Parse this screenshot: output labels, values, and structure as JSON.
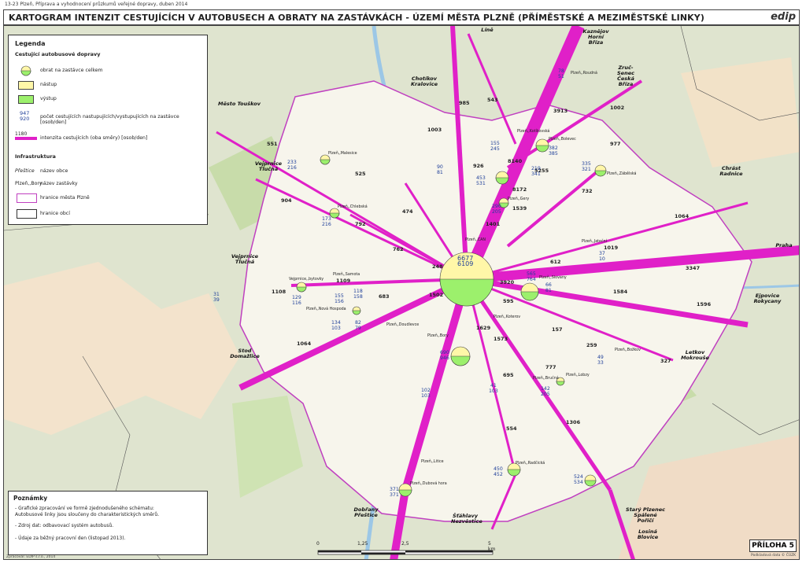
{
  "header": {
    "meta": "13-23 Plzeň, Příprava a vyhodnocení průzkumů veřejné dopravy, duben 2014",
    "title": "KARTOGRAM INTENZIT CESTUJÍCÍCH V AUTOBUSECH A OBRATY NA ZASTÁVKÁCH - ÚZEMÍ MĚSTA PLZNĚ (PŘÍMĚSTSKÉ A MEZIMĚSTSKÉ LINKY)",
    "logo": "edip"
  },
  "legend": {
    "title": "Legenda",
    "section_transport": "Cestující autobusové dopravy",
    "turnover": "obrat na zastávce celkem",
    "boarding": "nástup",
    "alighting": "výstup",
    "count_example_top": "947",
    "count_example_bottom": "920",
    "count_desc": "počet cestujících nastupujících/vystupujících na zastávce [osob/den]",
    "intensity_example": "1180",
    "intensity_desc": "intenzita cestujících (oba směry) [osob/den]",
    "section_infra": "Infrastruktura",
    "town_example": "Přeštice",
    "town_desc": "název obce",
    "stop_example": "Plzeň,,Bory",
    "stop_desc": "název zastávky",
    "city_boundary": "hranice města Plzně",
    "municipal_boundary": "hranice obcí",
    "colors": {
      "boarding": "#fff7a8",
      "alighting": "#9cf06c",
      "flow": "#e020c8",
      "city_boundary": "#c040c0"
    }
  },
  "notes": {
    "title": "Poznámky",
    "lines": [
      "- Grafické zpracování ve formě zjednodušeného schématu:",
      "  Autobusové linky jsou sloučeny do charakteristických směrů.",
      "- Zdroj dat: odbavovací systém autobusů.",
      "- Údaje za běžný pracovní den (listopad 2013)."
    ]
  },
  "scale": {
    "ticks": [
      "0",
      "1,25",
      "2,5",
      "5 km"
    ]
  },
  "annex": "PŘÍLOHA 5",
  "footer": {
    "left": "Zpracoval: EDIP s.r.o., 2014",
    "right": "Podkladová data © ČÚZK"
  },
  "directions": [
    "Město Touškov",
    "Vejprnice Tlučná",
    "Vejprnice Tlučná",
    "Stod Domažlice",
    "Dobřany Přeštice",
    "Chotíkov Kralovice",
    "Líně",
    "Kaznějov Horní Bříza",
    "Zruč-Senec Česká Bříza",
    "Chrást Radnice",
    "Praha",
    "Ejpovice Rokycany",
    "Letkov Mokrouše",
    "Starý Plzenec Spálené Poříčí",
    "Losiná Blovice",
    "Šťáhlavy Nezvěstice"
  ],
  "flows": [
    "551",
    "525",
    "904",
    "792",
    "474",
    "762",
    "248",
    "1109",
    "1108",
    "683",
    "1502",
    "1064",
    "926",
    "1003",
    "8140",
    "5255",
    "8172",
    "985",
    "1401",
    "1539",
    "543",
    "3913",
    "1002",
    "977",
    "732",
    "1064",
    "1019",
    "3347",
    "1584",
    "1596",
    "157",
    "259",
    "327",
    "1629",
    "1573",
    "695",
    "777",
    "1306",
    "554",
    "595",
    "612",
    "3920"
  ],
  "counts": [
    [
      "233",
      "216"
    ],
    [
      "173",
      "216"
    ],
    [
      "129",
      "116"
    ],
    [
      "155",
      "156"
    ],
    [
      "118",
      "158"
    ],
    [
      "134",
      "103"
    ],
    [
      "82",
      "79"
    ],
    [
      "90",
      "81"
    ],
    [
      "155",
      "245"
    ],
    [
      "453",
      "531"
    ],
    [
      "382",
      "385"
    ],
    [
      "219",
      "341"
    ],
    [
      "335",
      "321"
    ],
    [
      "290",
      "205"
    ],
    [
      "6677",
      "6109"
    ],
    [
      "565",
      "764"
    ],
    [
      "66",
      "81"
    ],
    [
      "37",
      "10"
    ],
    [
      "690",
      "946"
    ],
    [
      "102",
      "103"
    ],
    [
      "41",
      "103"
    ],
    [
      "142",
      "205"
    ],
    [
      "450",
      "452"
    ],
    [
      "371",
      "371"
    ],
    [
      "524",
      "534"
    ],
    [
      "78",
      "51"
    ],
    [
      "31",
      "39"
    ],
    [
      "49",
      "33"
    ]
  ],
  "stops": [
    "Plzeň,,Malesice",
    "Plzeň,,Chlebská",
    "Plzeň,,Samota",
    "Vejprnice,,bytovky",
    "Plzeň,,Nová Hospoda",
    "Plzeň,,CAN",
    "Plzeň,,Bory",
    "Plzeň,,Slovany",
    "Plzeň,,Lobzy",
    "Plzeň,,Radčická",
    "Plzeň,,Litice",
    "Plzeň,,Dubová hora",
    "Plzeň,,Gery",
    "Plzeň,,Kotíkovská",
    "Plzeň,,Doudlevce",
    "Plzeň,,Koterov",
    "Plzeň,,Zábělská",
    "Plzeň,,Bolevec",
    "Plzeň,,Jateční",
    "Plzeň,,Božkov",
    "Plzeň,,Bručná",
    "Plzeň,,Roudná"
  ]
}
